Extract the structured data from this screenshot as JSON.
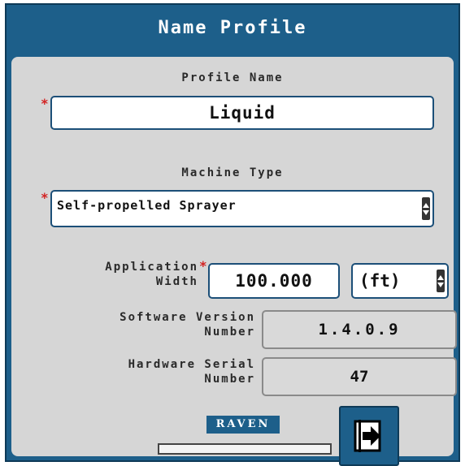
{
  "title": "Name Profile",
  "profile_name": {
    "label": "Profile Name",
    "value": "Liquid",
    "required_mark": "*"
  },
  "machine_type": {
    "label": "Machine Type",
    "value": "Self-propelled Sprayer",
    "required_mark": "*"
  },
  "application_width": {
    "label_line1": "Application",
    "label_line2": "Width",
    "required_mark": "*",
    "value": "100.000",
    "unit": "(ft)"
  },
  "software_version": {
    "label_line1": "Software Version",
    "label_line2": "Number",
    "value": "1.4.0.9"
  },
  "hardware_serial": {
    "label_line1": "Hardware Serial",
    "label_line2": "Number",
    "value": "47"
  },
  "brand": "RAVEN",
  "icons": {
    "next": "next-arrow-icon",
    "spinner": "up-down-spinner-icon"
  },
  "colors": {
    "frame": "#1d5f8a",
    "panel": "#d6d6d6",
    "required": "#d32222"
  }
}
